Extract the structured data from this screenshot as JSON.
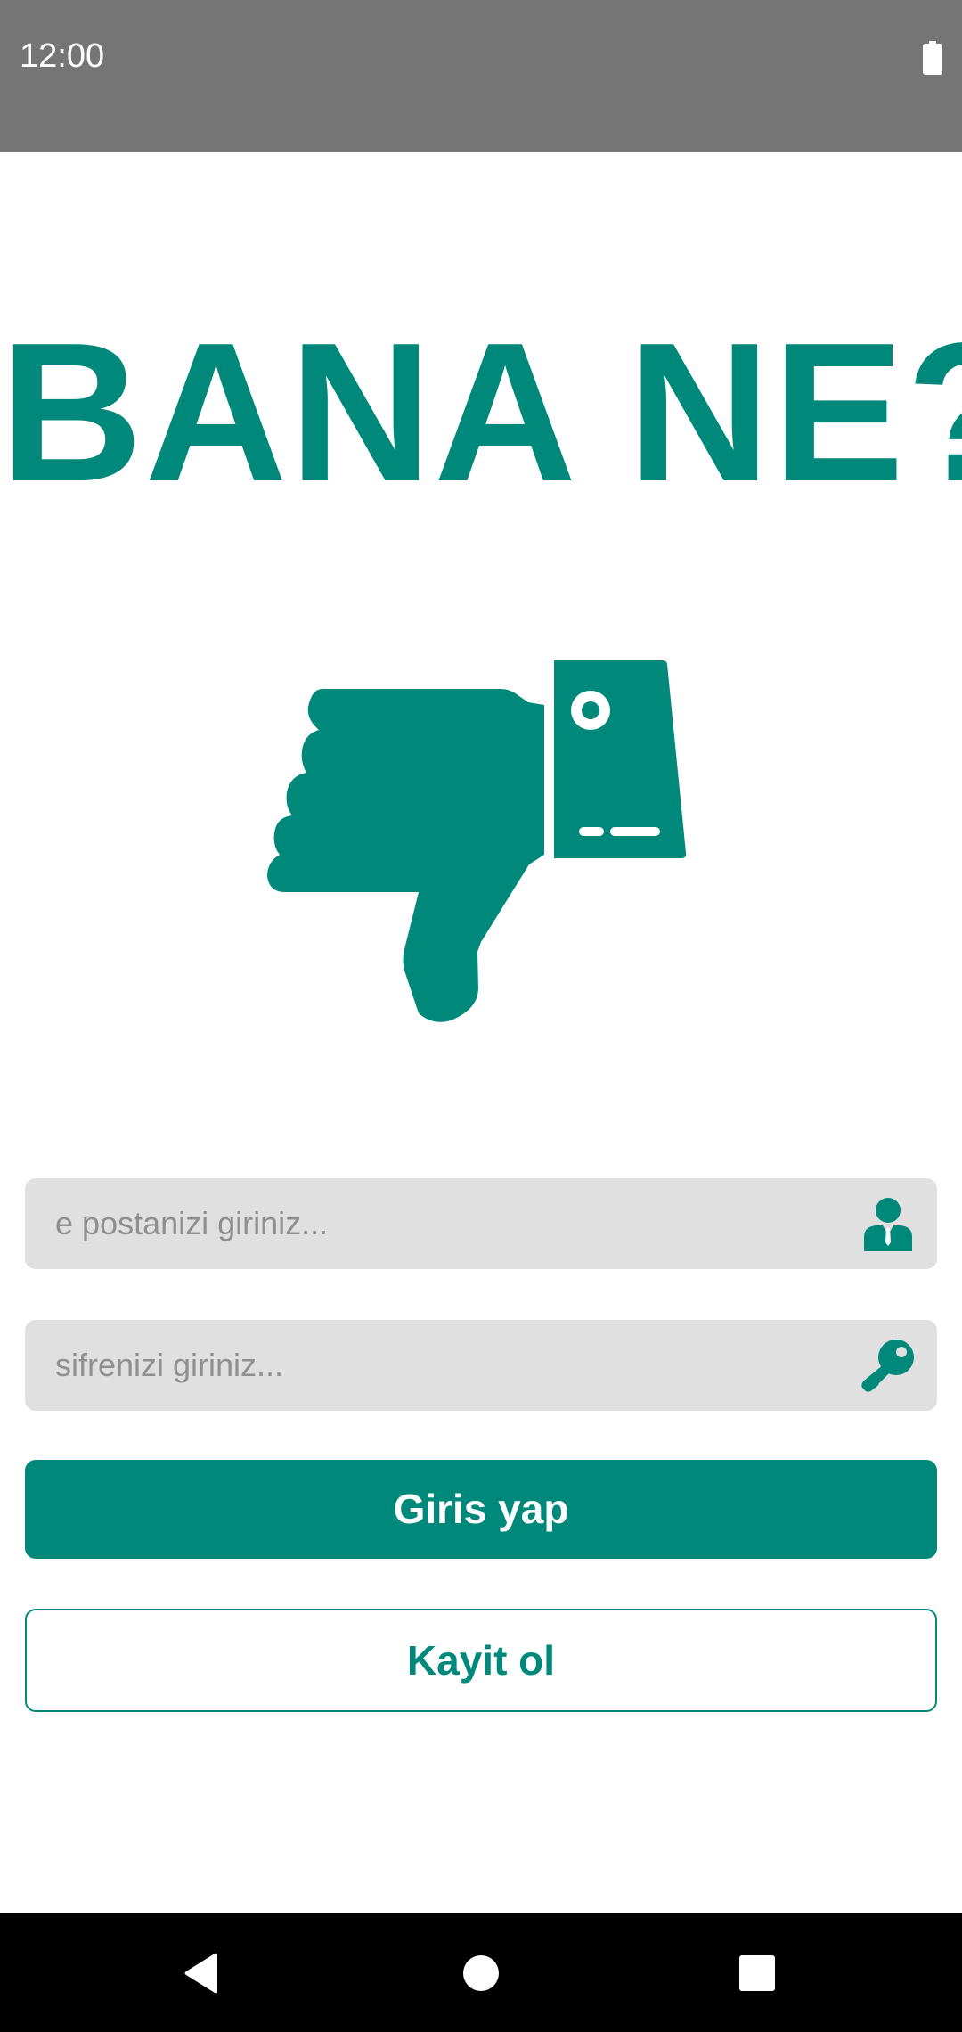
{
  "status_bar": {
    "time": "12:00",
    "battery_icon": "battery-full-icon"
  },
  "app": {
    "title": "BANA NE?",
    "logo_icon": "thumbs-down-icon"
  },
  "login_form": {
    "email": {
      "placeholder": "e postanizi giriniz...",
      "value": "",
      "icon": "user-icon"
    },
    "password": {
      "placeholder": "sifrenizi giriniz...",
      "value": "",
      "icon": "key-icon"
    },
    "login_label": "Giris yap",
    "register_label": "Kayit ol"
  },
  "nav_bar": {
    "back_icon": "back-triangle-icon",
    "home_icon": "home-circle-icon",
    "recents_icon": "recents-square-icon"
  },
  "colors": {
    "accent": "#00897b",
    "status_bar": "#757575",
    "field_background": "#e0e0e0",
    "nav_bar": "#000000"
  }
}
